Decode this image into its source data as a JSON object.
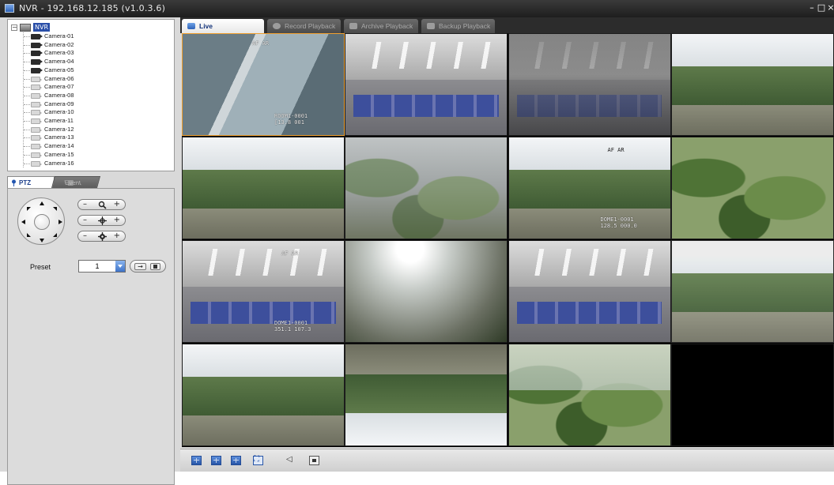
{
  "window": {
    "title": "NVR - 192.168.12.185 (v1.0.3.6)",
    "minimize_glyph": "–",
    "maximize_glyph": "□",
    "close_glyph": "×"
  },
  "tree": {
    "root_label": "NVR",
    "cameras": [
      {
        "label": "Camera-01",
        "active": true
      },
      {
        "label": "Camera-02",
        "active": true
      },
      {
        "label": "Camera-03",
        "active": true
      },
      {
        "label": "Camera-04",
        "active": true
      },
      {
        "label": "Camera-05",
        "active": true
      },
      {
        "label": "Camera-06",
        "active": false
      },
      {
        "label": "Camera-07",
        "active": false
      },
      {
        "label": "Camera-08",
        "active": false
      },
      {
        "label": "Camera-09",
        "active": false
      },
      {
        "label": "Camera-10",
        "active": false
      },
      {
        "label": "Camera-11",
        "active": false
      },
      {
        "label": "Camera-12",
        "active": false
      },
      {
        "label": "Camera-13",
        "active": false
      },
      {
        "label": "Camera-14",
        "active": false
      },
      {
        "label": "Camera-15",
        "active": false
      },
      {
        "label": "Camera-16",
        "active": false
      }
    ]
  },
  "ptz": {
    "tabs": {
      "ptz": "PTZ",
      "event": "Event"
    },
    "zoom": {
      "minus": "–",
      "plus": "+",
      "icon": "magnifier-icon"
    },
    "focus": {
      "minus": "–",
      "plus": "+",
      "icon": "focus-crosshair-icon"
    },
    "iris": {
      "minus": "–",
      "plus": "+",
      "icon": "iris-gear-icon"
    },
    "preset_label": "Preset",
    "preset_value": "1",
    "go_glyph": "→"
  },
  "main": {
    "tabs": {
      "live": "Live",
      "record": "Record Playback",
      "archive": "Archive Playback",
      "backup": "Backup Playback"
    },
    "active_tab": "live",
    "cells": [
      {
        "scene": "window",
        "osd": [
          {
            "text": "AF AR",
            "pos": "top-center",
            "dark": false
          },
          {
            "text": "ROOM1-0001\n[13.8 001",
            "pos": "bottom-right",
            "dark": false
          }
        ],
        "selected": true
      },
      {
        "scene": "office",
        "osd": [],
        "selected": false
      },
      {
        "scene": "office-dark",
        "osd": [],
        "selected": false
      },
      {
        "scene": "landscape",
        "osd": [],
        "selected": false
      },
      {
        "scene": "hills",
        "osd": [],
        "selected": false
      },
      {
        "scene": "foggy",
        "osd": [],
        "selected": false
      },
      {
        "scene": "hills-osd",
        "osd": [
          {
            "text": "AF AR",
            "pos": "top-right",
            "dark": true
          },
          {
            "text": "DOME1-0001\n128.5 000.0",
            "pos": "bottom-right",
            "dark": false
          }
        ],
        "selected": false
      },
      {
        "scene": "trees",
        "osd": [],
        "selected": false
      },
      {
        "scene": "office-wide",
        "osd": [
          {
            "text": "AF AR",
            "pos": "top-right",
            "dark": false
          },
          {
            "text": "DOME1-0001\n351.1 107.3",
            "pos": "bottom-right",
            "dark": false
          }
        ],
        "selected": false
      },
      {
        "scene": "sun",
        "osd": [],
        "selected": false
      },
      {
        "scene": "office",
        "osd": [],
        "selected": false
      },
      {
        "scene": "landscape-haze",
        "osd": [],
        "selected": false
      },
      {
        "scene": "landscape",
        "osd": [],
        "selected": false
      },
      {
        "scene": "landscape-flipped",
        "osd": [],
        "selected": false
      },
      {
        "scene": "trees-haze",
        "osd": [],
        "selected": false
      },
      {
        "scene": "empty",
        "osd": [],
        "selected": false
      }
    ]
  },
  "bottombar": {
    "buttons": [
      "layout-1x1-icon",
      "layout-2x2-icon",
      "layout-3x3-icon",
      "fullscreen-icon",
      "audio-icon",
      "snapshot-icon"
    ]
  },
  "colors": {
    "accent": "#2a4fa8",
    "selected_border": "#f0a030",
    "titlebar": "#2a2a2a"
  }
}
